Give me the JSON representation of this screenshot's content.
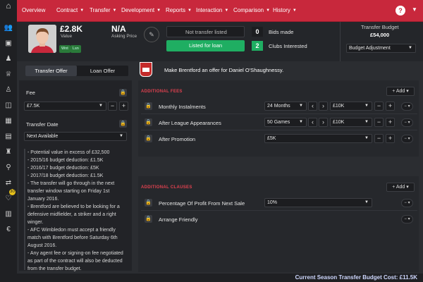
{
  "nav": {
    "menu": [
      "Overview",
      "Contract",
      "Transfer",
      "Development",
      "Reports",
      "Interaction",
      "Comparison",
      "History"
    ],
    "help": "?"
  },
  "player": {
    "value": "£2.8K",
    "value_label": "Value",
    "asking": "N/A",
    "asking_label": "Asking Price",
    "chip_wnt": "Wnt",
    "chip_lsn": "Lsn"
  },
  "transfer_status": {
    "listed_label": "Not transfer listed",
    "loan_button": "Listed for loan",
    "bids_count": "0",
    "bids_label": "Bids made",
    "clubs_count": "2",
    "clubs_label": "Clubs Interested"
  },
  "budget": {
    "title": "Transfer Budget",
    "amount": "£54,000",
    "adjust_label": "Budget Adjustment"
  },
  "offer": {
    "tab_transfer": "Transfer Offer",
    "tab_loan": "Loan Offer",
    "headline": "Make Brentford an offer for Daniel O'Shaughnessy.",
    "fee_label": "Fee",
    "fee_value": "£7.5K",
    "date_label": "Transfer Date",
    "date_value": "Next Available"
  },
  "notes": [
    "- Potential value in excess of £32,500",
    "- 2015/16 budget deduction: £1.5K",
    "- 2016/17 budget deduction: £5K",
    "- 2017/18 budget deduction: £1.5K",
    "- The transfer will go through in the next",
    "transfer window starting on Friday 1st",
    "January 2016.",
    "- Brentford are believed to be looking for a",
    "defensive midfielder, a striker and a right",
    "winger.",
    "- AFC Wimbledon must accept a friendly",
    "match with Brentford before Saturday 6th",
    "August 2016.",
    "- Any agent fee or signing-on fee negotiated",
    "as part of the contract will also be deducted",
    "from the transfer budget."
  ],
  "additional_fees": {
    "header": "ADDITIONAL FEES",
    "add_label": "Add",
    "rows": [
      {
        "label": "Monthly Instalments",
        "option": "24 Months",
        "amount": "£10K"
      },
      {
        "label": "After League Appearances",
        "option": "50 Games",
        "amount": "£10K"
      },
      {
        "label": "After Promotion",
        "amount": "£5K"
      }
    ]
  },
  "additional_clauses": {
    "header": "ADDITIONAL CLAUSES",
    "add_label": "Add",
    "rows": [
      {
        "label": "Percentage Of Profit From Next Sale",
        "value": "10%"
      },
      {
        "label": "Arrange Friendly"
      }
    ]
  },
  "footer": {
    "cost": "Current Season Transfer Budget Cost: £11.5K"
  },
  "icons": [
    "people-icon",
    "inbox-icon",
    "squad-icon",
    "trophy-icon",
    "tactics-icon",
    "staff-icon",
    "calendar-icon",
    "report-icon",
    "board-icon",
    "search-icon",
    "transfers-icon",
    "medical-icon",
    "finance-icon",
    "money-icon"
  ],
  "colors": {
    "accent": "#c8283c",
    "green": "#1fae62",
    "section_header": "#e0414f"
  }
}
